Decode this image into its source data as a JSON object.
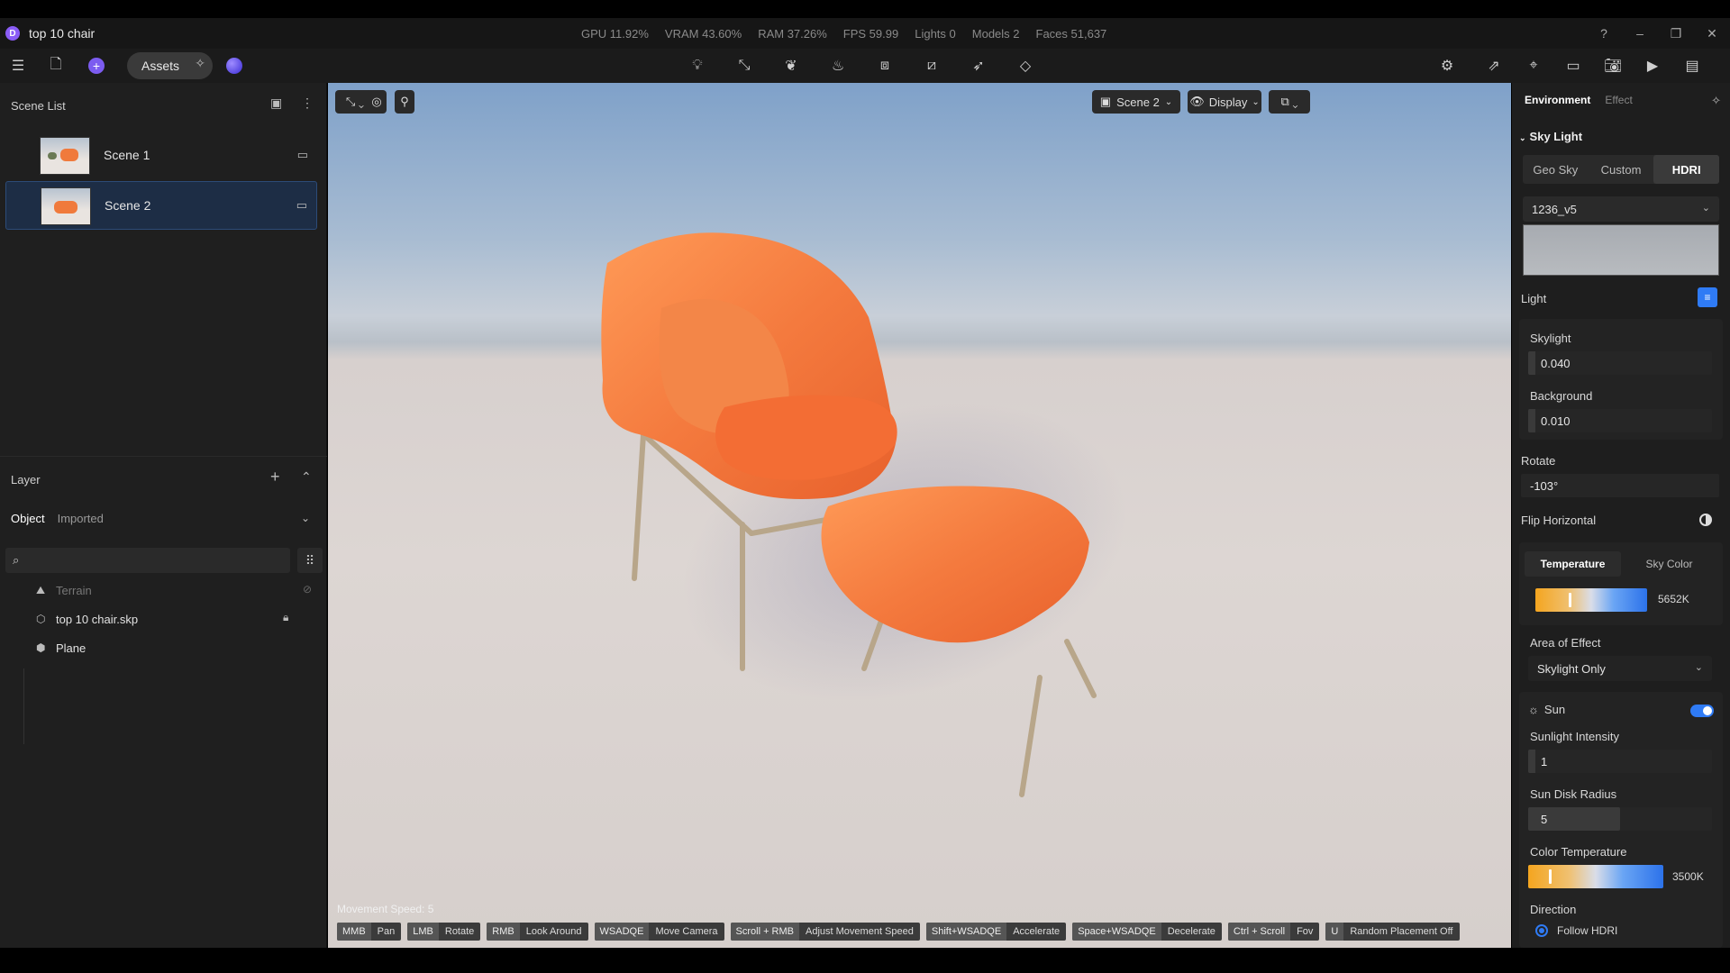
{
  "app": {
    "title": "top 10 chair"
  },
  "stats": {
    "gpu": "GPU 11.92%",
    "vram": "VRAM 43.60%",
    "ram": "RAM 37.26%",
    "fps": "FPS 59.99",
    "lights": "Lights 0",
    "models": "Models 2",
    "faces": "Faces 51,637"
  },
  "toolbar": {
    "assets_label": "Assets"
  },
  "scene_list": {
    "title": "Scene List",
    "items": [
      {
        "label": "Scene 1"
      },
      {
        "label": "Scene 2"
      }
    ]
  },
  "layer": {
    "title": "Layer",
    "tabs": [
      "Object",
      "Imported"
    ],
    "items": [
      {
        "label": "Terrain"
      },
      {
        "label": "top 10 chair.skp"
      },
      {
        "label": "Plane"
      }
    ]
  },
  "viewport": {
    "scene_select": "Scene 2",
    "display_label": "Display",
    "movement_speed": "Movement Speed: 5",
    "hints": [
      {
        "key": "MMB",
        "action": "Pan"
      },
      {
        "key": "LMB",
        "action": "Rotate"
      },
      {
        "key": "RMB",
        "action": "Look Around"
      },
      {
        "key": "WSADQE",
        "action": "Move Camera"
      },
      {
        "key": "Scroll + RMB",
        "action": "Adjust Movement Speed"
      },
      {
        "key": "Shift+WSADQE",
        "action": "Accelerate"
      },
      {
        "key": "Space+WSADQE",
        "action": "Decelerate"
      },
      {
        "key": "Ctrl + Scroll",
        "action": "Fov"
      },
      {
        "key": "U",
        "action": "Random Placement Off"
      }
    ]
  },
  "env": {
    "tabs": [
      "Environment",
      "Effect"
    ],
    "sky_light_title": "Sky Light",
    "sky_modes": [
      "Geo Sky",
      "Custom",
      "HDRI"
    ],
    "sky_mode_selected": "HDRI",
    "hdri_name": "1236_v5",
    "light_label": "Light",
    "skylight_label": "Skylight",
    "skylight_value": "0.040",
    "background_label": "Background",
    "background_value": "0.010",
    "rotate_label": "Rotate",
    "rotate_value": "-103°",
    "flip_label": "Flip Horizontal",
    "temp_tabs": [
      "Temperature",
      "Sky Color"
    ],
    "temperature_value": "5652K",
    "temperature_fraction": 0.3,
    "area_label": "Area of Effect",
    "area_value": "Skylight Only",
    "sun_label": "Sun",
    "sun_on": true,
    "sun_intensity_label": "Sunlight Intensity",
    "sun_intensity_value": "1",
    "sun_disk_label": "Sun Disk Radius",
    "sun_disk_value": "5",
    "sun_disk_fraction": 0.5,
    "color_temp_label": "Color Temperature",
    "color_temp_value": "3500K",
    "color_temp_fraction": 0.15,
    "direction_label": "Direction",
    "follow_hdri_label": "Follow HDRI"
  },
  "colors": {
    "accent": "#2f7bf5",
    "chair_orange": "#f07a3c"
  }
}
